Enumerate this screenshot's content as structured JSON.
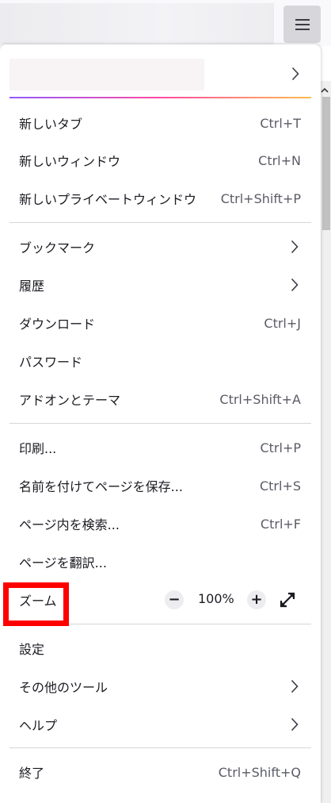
{
  "menu": {
    "new_tab": {
      "label": "新しいタブ",
      "shortcut": "Ctrl+T"
    },
    "new_window": {
      "label": "新しいウィンドウ",
      "shortcut": "Ctrl+N"
    },
    "new_private_window": {
      "label": "新しいプライベートウィンドウ",
      "shortcut": "Ctrl+Shift+P"
    },
    "bookmarks": {
      "label": "ブックマーク"
    },
    "history": {
      "label": "履歴"
    },
    "downloads": {
      "label": "ダウンロード",
      "shortcut": "Ctrl+J"
    },
    "passwords": {
      "label": "パスワード"
    },
    "addons": {
      "label": "アドオンとテーマ",
      "shortcut": "Ctrl+Shift+A"
    },
    "print": {
      "label": "印刷...",
      "shortcut": "Ctrl+P"
    },
    "save_page": {
      "label": "名前を付けてページを保存...",
      "shortcut": "Ctrl+S"
    },
    "find_in_page": {
      "label": "ページ内を検索...",
      "shortcut": "Ctrl+F"
    },
    "translate_page": {
      "label": "ページを翻訳..."
    },
    "zoom": {
      "label": "ズーム",
      "value": "100%",
      "minus": "−",
      "plus": "+"
    },
    "settings": {
      "label": "設定"
    },
    "more_tools": {
      "label": "その他のツール"
    },
    "help": {
      "label": "ヘルプ"
    },
    "quit": {
      "label": "終了",
      "shortcut": "Ctrl+Shift+Q"
    }
  },
  "icons": {
    "app_menu": "hamburger-icon",
    "submenu": "chevron-right-icon",
    "fullscreen": "fullscreen-icon"
  },
  "colors": {
    "highlight": "#ff0000",
    "accent_gradient": [
      "#9059ff",
      "#ff4aa2",
      "#ffbd4f"
    ],
    "button_active": "#d7d7db"
  }
}
